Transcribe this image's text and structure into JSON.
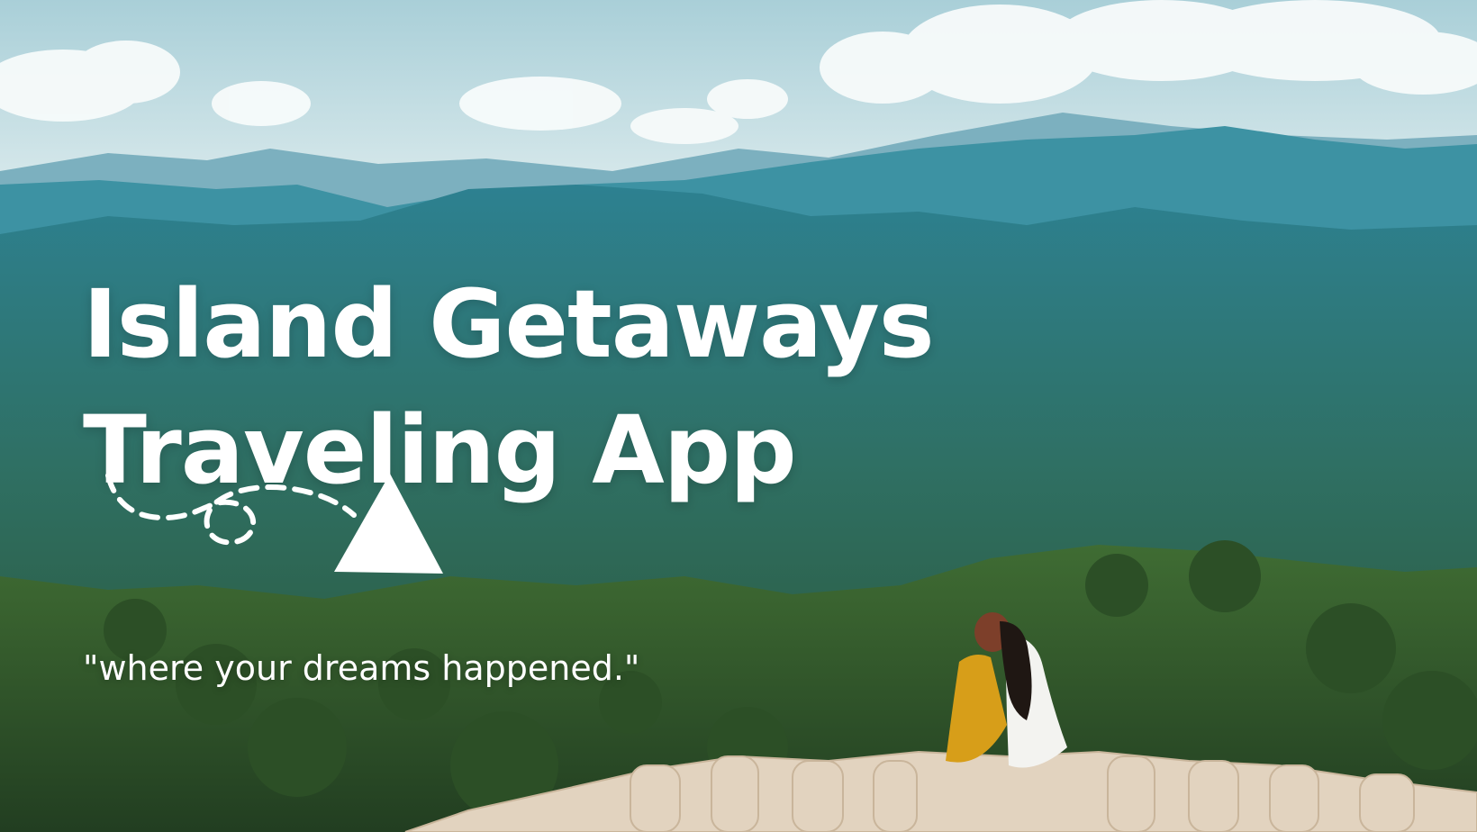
{
  "hero": {
    "title_line_1": "Island Getaways",
    "title_line_2": "Traveling App",
    "tagline": "\"where your dreams happened.\""
  },
  "colors": {
    "sky_top": "#b7d6dc",
    "sky_bottom": "#dcecee",
    "distant_mountains": "#6aa5b7",
    "mid_mountains": "#2f8a9a",
    "forest": "#2f6a4e",
    "foreground_trees": "#315a2c",
    "text": "#ffffff",
    "person_dress": "#d79e19",
    "rocks": "#e2d3bf"
  },
  "icons": {
    "arrow": "dashed-loop-arrow-icon"
  }
}
